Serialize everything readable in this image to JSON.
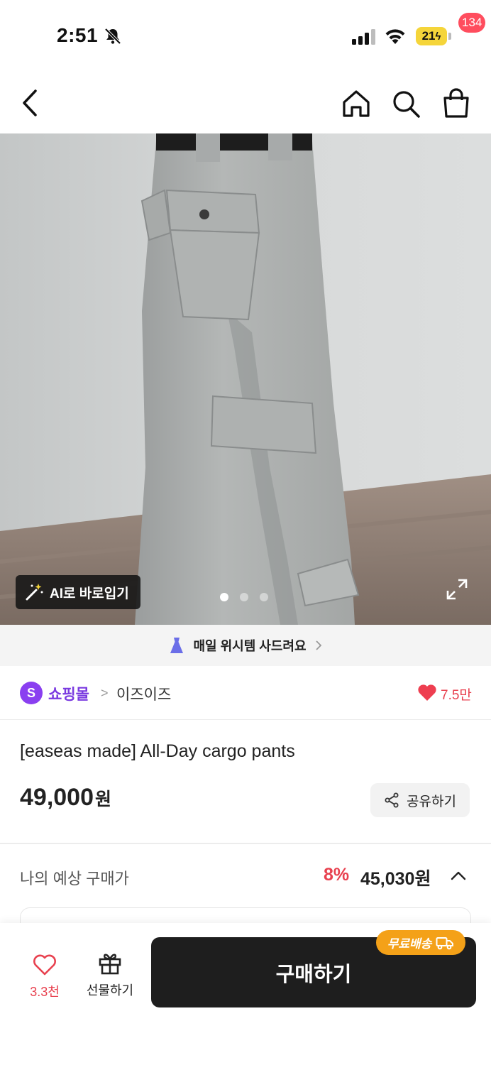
{
  "status_bar": {
    "time": "2:51",
    "battery": "21"
  },
  "nav": {
    "cart_badge": "134"
  },
  "photo": {
    "ai_button_label": "AI로 바로입기",
    "page_count": 3,
    "current_page": 1
  },
  "banner": {
    "text": "매일 위시템 사드려요"
  },
  "shop": {
    "logo_letter": "S",
    "type": "쇼핑몰",
    "separator": ">",
    "name": "이즈이즈",
    "likes": "7.5만"
  },
  "product": {
    "title": "[easeas made] All-Day cargo pants",
    "price": "49,000",
    "price_unit": "원",
    "share_label": "공유하기"
  },
  "estimate": {
    "label": "나의 예상 구매가",
    "discount": "8%",
    "price": "45,030원"
  },
  "bottom_bar": {
    "wish_count": "3.3천",
    "gift_label": "선물하기",
    "buy_label": "구매하기",
    "free_shipping": "무료배송"
  },
  "colors": {
    "accent_red": "#e8414f",
    "shop_purple": "#7a3ae0",
    "shipping_orange": "#f4a118",
    "buy_button": "#1e1e1e"
  }
}
